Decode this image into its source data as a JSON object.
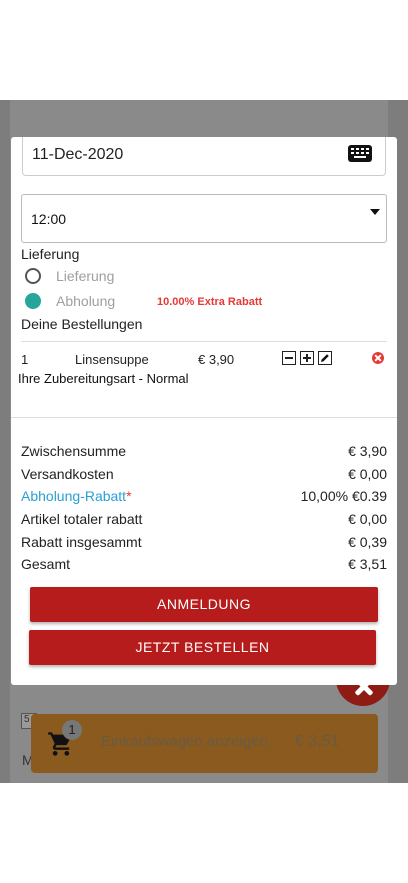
{
  "background": {
    "cart": {
      "count": "1",
      "label": "Einkaufswagen anzeigen",
      "total": "€ 3,51"
    },
    "small_input_text": "5",
    "partial_letter": "M"
  },
  "order_form": {
    "date_value": "11-Dec-2020",
    "time_value": "12:00",
    "delivery_section_label": "Lieferung",
    "delivery_options": [
      {
        "label": "Lieferung",
        "selected": false
      },
      {
        "label": "Abholung",
        "selected": true,
        "badge": "10.00% Extra Rabatt"
      }
    ],
    "orders_label": "Deine Bestellungen",
    "items": [
      {
        "qty": "1",
        "name": "Linsensuppe",
        "price": "€ 3,90",
        "preparation": "Ihre Zubereitungsart - Normal"
      }
    ],
    "summary": {
      "subtotal_label": "Zwischensumme",
      "subtotal_value": "€ 3,90",
      "shipping_label": "Versandkosten",
      "shipping_value": "€ 0,00",
      "pickup_discount_label": "Abholung-Rabatt",
      "pickup_discount_star": "*",
      "pickup_discount_value": "10,00% €0.39",
      "item_discount_label": "Artikel totaler rabatt",
      "item_discount_value": "€ 0,00",
      "total_discount_label": "Rabatt insgesammt",
      "total_discount_value": "€ 0,39",
      "total_label": "Gesamt",
      "total_value": "€ 3,51"
    },
    "login_button": "ANMELDUNG",
    "order_button": "JETZT BESTELLEN"
  },
  "colors": {
    "primary_button": "#b71c1c",
    "radio_selected": "#26a69a",
    "extra_discount": "#e53935",
    "link": "#2a9fd6"
  }
}
